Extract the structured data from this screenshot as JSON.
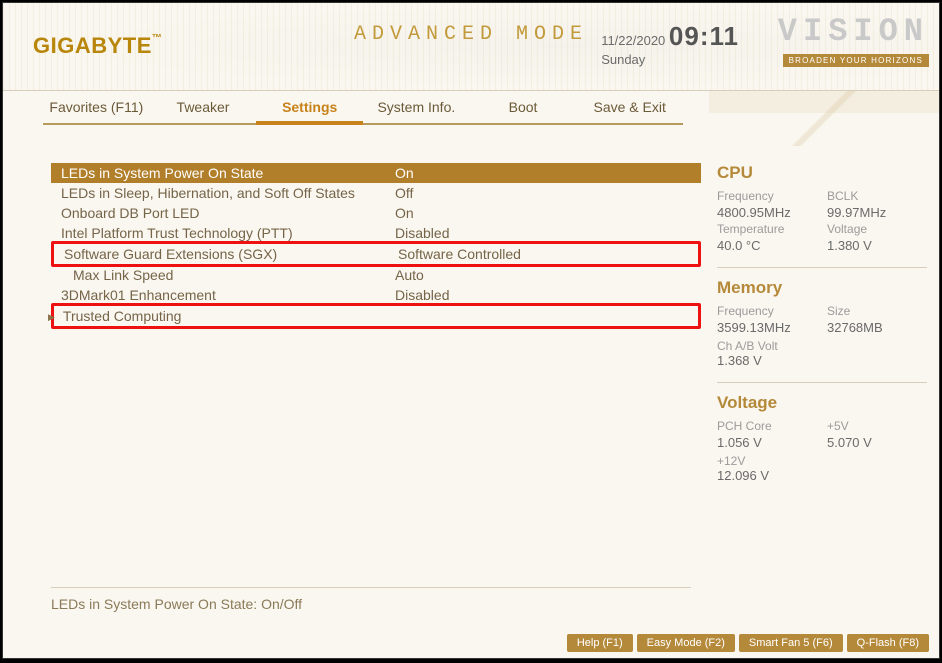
{
  "header": {
    "brand": "GIGABYTE",
    "mode": "ADVANCED MODE",
    "date": "11/22/2020",
    "day": "Sunday",
    "time": "09:11",
    "vision_logo": "VISION",
    "vision_tag": "BROADEN YOUR HORIZONS"
  },
  "tabs": [
    {
      "label": "Favorites (F11)",
      "active": false
    },
    {
      "label": "Tweaker",
      "active": false
    },
    {
      "label": "Settings",
      "active": true
    },
    {
      "label": "System Info.",
      "active": false
    },
    {
      "label": "Boot",
      "active": false
    },
    {
      "label": "Save & Exit",
      "active": false
    }
  ],
  "settings": [
    {
      "label": "LEDs in System Power On State",
      "value": "On",
      "highlight": true
    },
    {
      "label": "LEDs in Sleep, Hibernation, and Soft Off States",
      "value": "Off"
    },
    {
      "label": "Onboard DB Port LED",
      "value": "On"
    },
    {
      "label": "Intel Platform Trust Technology (PTT)",
      "value": "Disabled"
    },
    {
      "label": "Software Guard Extensions (SGX)",
      "value": "Software Controlled",
      "redbox": true
    },
    {
      "label": "Max Link Speed",
      "value": "Auto",
      "indent": true
    },
    {
      "label": "3DMark01 Enhancement",
      "value": "Disabled"
    },
    {
      "label": "Trusted Computing",
      "value": "",
      "submenu": true,
      "redbox": true
    }
  ],
  "side": {
    "cpu": {
      "title": "CPU",
      "freq_k": "Frequency",
      "freq_v": "4800.95MHz",
      "bclk_k": "BCLK",
      "bclk_v": "99.97MHz",
      "temp_k": "Temperature",
      "temp_v": "40.0 °C",
      "volt_k": "Voltage",
      "volt_v": "1.380 V"
    },
    "memory": {
      "title": "Memory",
      "freq_k": "Frequency",
      "freq_v": "3599.13MHz",
      "size_k": "Size",
      "size_v": "32768MB",
      "chab_k": "Ch A/B Volt",
      "chab_v": "1.368 V"
    },
    "voltage": {
      "title": "Voltage",
      "pch_k": "PCH Core",
      "pch_v": "1.056 V",
      "p5_k": "+5V",
      "p5_v": "5.070 V",
      "p12_k": "+12V",
      "p12_v": "12.096 V"
    }
  },
  "hint": "LEDs in System Power On State: On/Off",
  "footer": [
    {
      "label": "Help (F1)"
    },
    {
      "label": "Easy Mode (F2)"
    },
    {
      "label": "Smart Fan 5 (F6)"
    },
    {
      "label": "Q-Flash (F8)"
    }
  ]
}
